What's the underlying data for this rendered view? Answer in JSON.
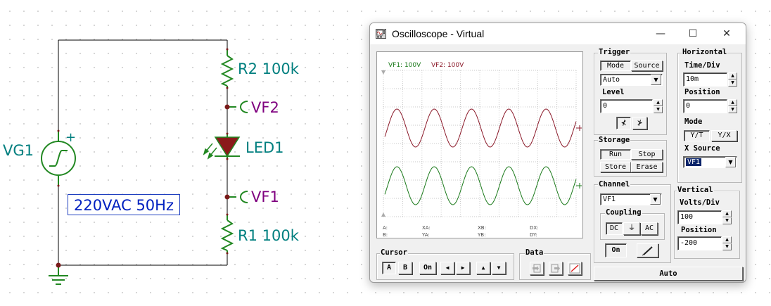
{
  "schematic": {
    "source_name": "VG1",
    "source_value": "220VAC 50Hz",
    "r2_label": "R2 100k",
    "r1_label": "R1 100k",
    "led_label": "LED1",
    "vf2_label": "VF2",
    "vf1_label": "VF1",
    "plus_sign": "+"
  },
  "window": {
    "title": "Oscilloscope - Virtual",
    "minimize_glyph": "—",
    "maximize_glyph": "☐",
    "close_glyph": "✕"
  },
  "screen": {
    "ch1_label": "VF1: 100V",
    "ch2_label": "VF2: 100V",
    "readout": [
      "A:",
      "XA:",
      "XB:",
      "DX:",
      "B:",
      "YA:",
      "YB:",
      "DY:"
    ],
    "colors": {
      "vf1": "#1b7a1b",
      "vf2": "#8b1a2a"
    }
  },
  "trigger": {
    "title": "Trigger",
    "mode_btn": "Mode",
    "source_btn": "Source",
    "mode_value": "Auto",
    "level_label": "Level",
    "level_value": "0",
    "edge_rising": "⊀",
    "edge_falling": "⊁"
  },
  "storage": {
    "title": "Storage",
    "run": "Run",
    "stop": "Stop",
    "store": "Store",
    "erase": "Erase"
  },
  "horizontal": {
    "title": "Horizontal",
    "time_div_label": "Time/Div",
    "time_div_value": "10m",
    "position_label": "Position",
    "position_value": "0",
    "mode_label": "Mode",
    "yt": "Y/T",
    "yx": "Y/X",
    "xsource_label": "X Source",
    "xsource_value": "VF1"
  },
  "channel": {
    "title": "Channel",
    "value": "VF1",
    "coupling_title": "Coupling",
    "dc": "DC",
    "gnd": "⏚",
    "ac": "AC",
    "on": "On"
  },
  "vertical": {
    "title": "Vertical",
    "volts_div_label": "Volts/Div",
    "volts_div_value": "100",
    "position_label": "Position",
    "position_value": "-200"
  },
  "cursor": {
    "title": "Cursor",
    "a": "A",
    "b": "B",
    "on": "On",
    "left": "◀",
    "right": "▶",
    "up": "▲",
    "down": "▼"
  },
  "data_group": {
    "title": "Data"
  },
  "status": "Auto"
}
